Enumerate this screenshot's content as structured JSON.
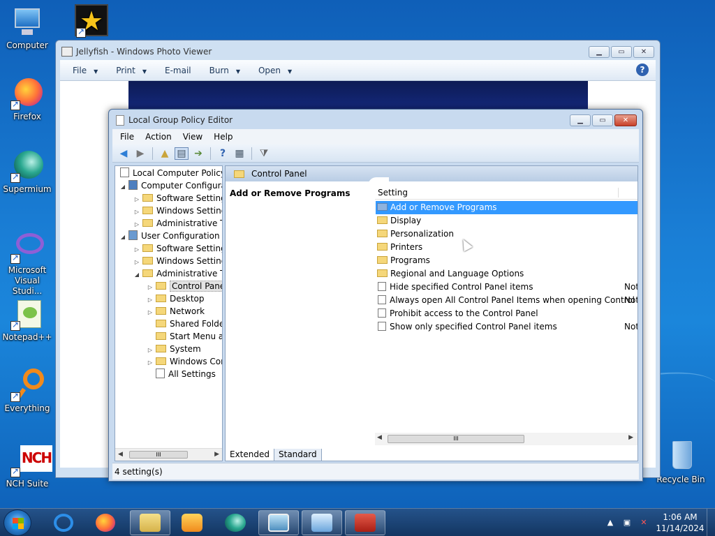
{
  "desktop": {
    "icons": [
      {
        "label": "Computer",
        "icon": "computer-icon"
      },
      {
        "label": "Firefox",
        "icon": "firefox-icon"
      },
      {
        "label": "Supermium",
        "icon": "supermium-icon"
      },
      {
        "label": "Microsoft Visual Studio",
        "label_line1": "Microsoft",
        "label_line2": "Visual Studi...",
        "icon": "visual-studio-icon"
      },
      {
        "label": "Notepad++",
        "icon": "notepadpp-icon"
      },
      {
        "label": "Everything",
        "icon": "everything-icon"
      },
      {
        "label": "NCH Suite",
        "icon": "nch-suite-icon"
      },
      {
        "label": "Recycle Bin",
        "icon": "recycle-bin-icon"
      }
    ]
  },
  "photo_viewer": {
    "title": "Jellyfish - Windows Photo Viewer",
    "menu": [
      "File",
      "Print",
      "E-mail",
      "Burn",
      "Open"
    ],
    "help": "?"
  },
  "gpe": {
    "title": "Local Group Policy Editor",
    "menu": [
      "File",
      "Action",
      "View",
      "Help"
    ],
    "tree": [
      {
        "label": "Local Computer Policy"
      },
      {
        "label": "Computer Configura"
      },
      {
        "label": "Software Settings"
      },
      {
        "label": "Windows Setting"
      },
      {
        "label": "Administrative Te"
      },
      {
        "label": "User Configuration"
      },
      {
        "label": "Software Settings"
      },
      {
        "label": "Windows Setting"
      },
      {
        "label": "Administrative Te"
      },
      {
        "label": "Control Panel"
      },
      {
        "label": "Desktop"
      },
      {
        "label": "Network"
      },
      {
        "label": "Shared Folder"
      },
      {
        "label": "Start Menu ar"
      },
      {
        "label": "System"
      },
      {
        "label": "Windows Cor"
      },
      {
        "label": "All Settings"
      }
    ],
    "tree_scroll_thumb": "III",
    "header": "Control Panel",
    "extended_title": "Add or Remove Programs",
    "column": "Setting",
    "items": [
      {
        "label": "Add or Remove Programs",
        "state": ""
      },
      {
        "label": "Display",
        "state": ""
      },
      {
        "label": "Personalization",
        "state": ""
      },
      {
        "label": "Printers",
        "state": ""
      },
      {
        "label": "Programs",
        "state": ""
      },
      {
        "label": "Regional and Language Options",
        "state": ""
      },
      {
        "label": "Hide specified Control Panel items",
        "state": "Not"
      },
      {
        "label": "Always open All Control Panel Items when opening Control ...",
        "state": "Not"
      },
      {
        "label": "Prohibit access to the Control Panel",
        "state": ""
      },
      {
        "label": "Show only specified Control Panel items",
        "state": "Not"
      }
    ],
    "list_scroll_thumb": "III",
    "tabs": [
      "Extended",
      "Standard"
    ],
    "status": "4 setting(s)"
  },
  "taskbar": {
    "time": "1:06 AM",
    "date": "11/14/2024"
  }
}
